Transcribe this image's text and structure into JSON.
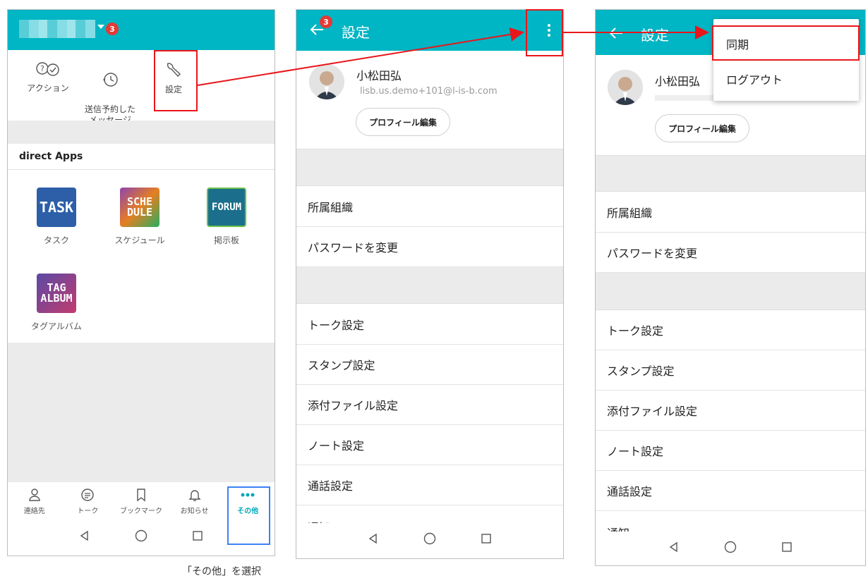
{
  "screen1": {
    "notification_count": "3",
    "quick_actions": [
      {
        "label": "アクション",
        "icon": "action-icon"
      },
      {
        "label": "送信予約した\nメッセージ",
        "icon": "scheduled-clock-icon"
      },
      {
        "label": "設定",
        "icon": "wrench-icon"
      }
    ],
    "section_title": "direct Apps",
    "apps": [
      {
        "label": "タスク",
        "logo_text": "TASK",
        "color": "#2c5fa8"
      },
      {
        "label": "スケジュール",
        "logo_text": "SCHE\nDULE",
        "color": "#8e44ad"
      },
      {
        "label": "掲示板",
        "logo_text": "FORUM",
        "color": "#1b6f8c"
      },
      {
        "label": "タグアルバム",
        "logo_text": "TAG\nALBUM",
        "color": "#8b3a62"
      }
    ],
    "bottom_tabs": [
      {
        "label": "連絡先",
        "icon": "person-icon"
      },
      {
        "label": "トーク",
        "icon": "chat-icon"
      },
      {
        "label": "ブックマーク",
        "icon": "bookmark-icon"
      },
      {
        "label": "お知らせ",
        "icon": "bell-icon"
      },
      {
        "label": "その他",
        "icon": "more-dots-icon"
      }
    ]
  },
  "settings": {
    "title": "設定",
    "badge": "3",
    "user_name": "小松田弘",
    "email": "lisb.us.demo+101@l-is-b.com",
    "profile_button": "プロフィール編集",
    "group1": [
      "所属組織",
      "パスワードを変更"
    ],
    "group2": [
      "トーク設定",
      "スタンプ設定",
      "添付ファイル設定",
      "ノート設定",
      "通話設定",
      "通知"
    ]
  },
  "overflow_menu": [
    "同期",
    "ログアウト"
  ],
  "caption": "「その他」を選択",
  "colors": {
    "accent": "#00b5c4",
    "highlight": "#e8161b",
    "blue_highlight": "#3b82f6",
    "badge": "#e53935"
  }
}
